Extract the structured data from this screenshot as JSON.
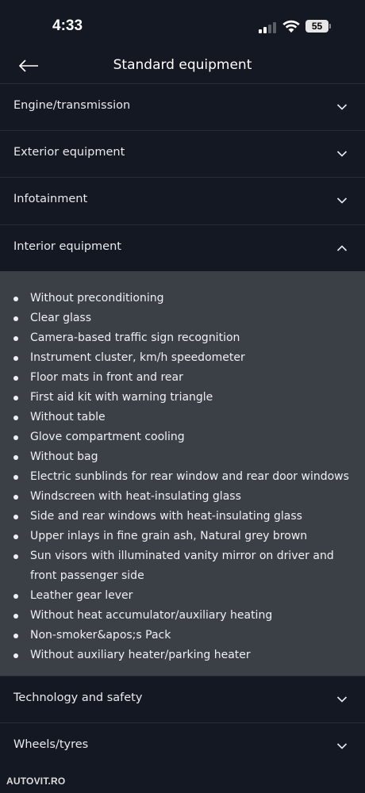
{
  "status_bar": {
    "time": "4:33",
    "battery": "55"
  },
  "header": {
    "title": "Standard equipment",
    "back_icon": "arrow-left-icon"
  },
  "sections": [
    {
      "label": "Engine/transmission",
      "expanded": false
    },
    {
      "label": "Exterior equipment",
      "expanded": false
    },
    {
      "label": "Infotainment",
      "expanded": false
    },
    {
      "label": "Interior equipment",
      "expanded": true
    },
    {
      "label": "Technology and safety",
      "expanded": false
    },
    {
      "label": "Wheels/tyres",
      "expanded": false
    }
  ],
  "interior_items": [
    "Without preconditioning",
    "Clear glass",
    "Camera-based traffic sign recognition",
    "Instrument cluster, km/h speedometer",
    "Floor mats in front and rear",
    "First aid kit with warning triangle",
    "Without table",
    "Glove compartment cooling",
    "Without bag",
    "Electric sunblinds for rear window and rear door windows",
    "Windscreen with heat-insulating glass",
    "Side and rear windows with heat-insulating glass",
    "Upper inlays in fine grain ash, Natural grey brown",
    "Sun visors with illuminated vanity mirror on driver and front passenger side",
    "Leather gear lever",
    "Without heat accumulator/auxiliary heating",
    "Non-smoker&apos;s Pack",
    "Without auxiliary heater/parking heater"
  ],
  "watermark": "AUTOVIT.RO",
  "colors": {
    "background": "#141822",
    "expanded_panel": "#3b3f46",
    "divider": "#272c37",
    "text": "#e8eaef"
  }
}
